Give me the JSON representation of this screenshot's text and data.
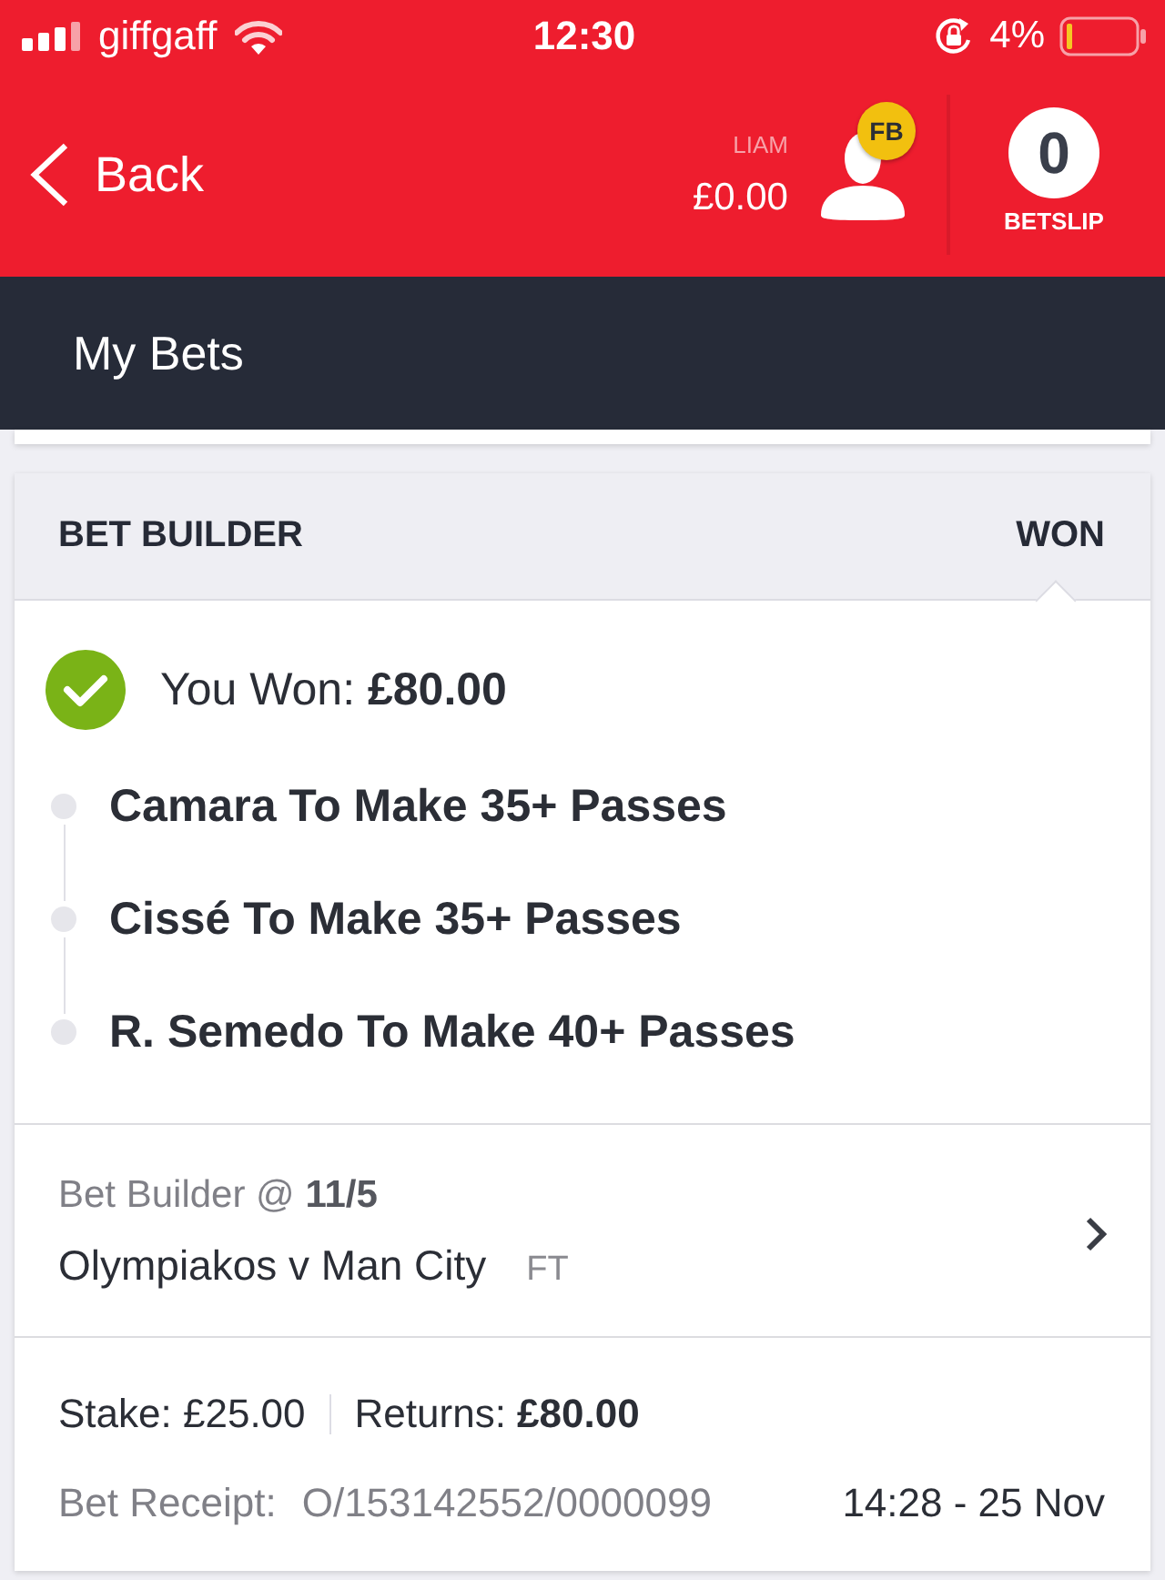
{
  "status_bar": {
    "carrier": "giffgaff",
    "time": "12:30",
    "battery": "4%"
  },
  "header": {
    "back": "Back",
    "username": "LIAM",
    "balance": "£0.00",
    "badge": "FB",
    "betslip_count": "0",
    "betslip_label": "BETSLIP"
  },
  "page": {
    "title": "My Bets"
  },
  "bet": {
    "type": "BET BUILDER",
    "result": "WON",
    "outcome": "You Won: **£80.00**",
    "selections": [
      "Camara To Make 35+ Passes",
      "Cissé To Make 35+ Passes",
      "R. Semedo To Make 40+ Passes"
    ],
    "market": "Bet Builder @ **11/5**",
    "event": "Olympiakos v Man City",
    "event_status": "FT",
    "stake": "Stake: £25.00",
    "returns": "Returns: **£80.00**",
    "receipt_label": "Bet Receipt:",
    "receipt_number": "O/153142552/0000099",
    "placed": "14:28 - 25 Nov"
  }
}
